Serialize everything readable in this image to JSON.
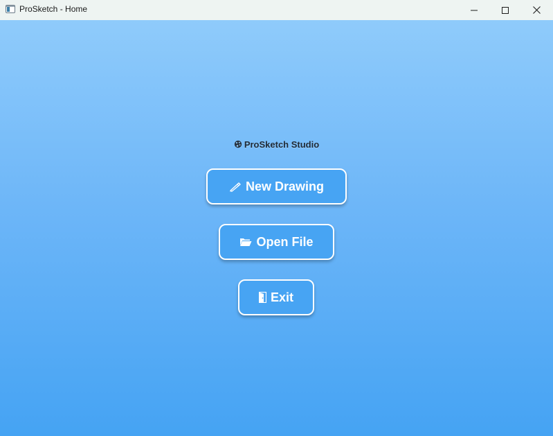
{
  "window": {
    "title": "ProSketch - Home",
    "controls": [
      "minimize",
      "maximize",
      "close"
    ]
  },
  "home": {
    "studio_title": "ProSketch Studio",
    "studio_icon": "palette-icon",
    "buttons": [
      {
        "label": "New Drawing",
        "icon": "pen-icon"
      },
      {
        "label": "Open File",
        "icon": "folder-open-icon"
      },
      {
        "label": "Exit",
        "icon": "door-icon"
      }
    ]
  },
  "colors": {
    "gradient_top": "#8fcbfb",
    "gradient_bottom": "#45a3f3",
    "button_fill": "#47a4f3",
    "button_border": "#ffffff",
    "titlebar": "#eef4f2"
  }
}
